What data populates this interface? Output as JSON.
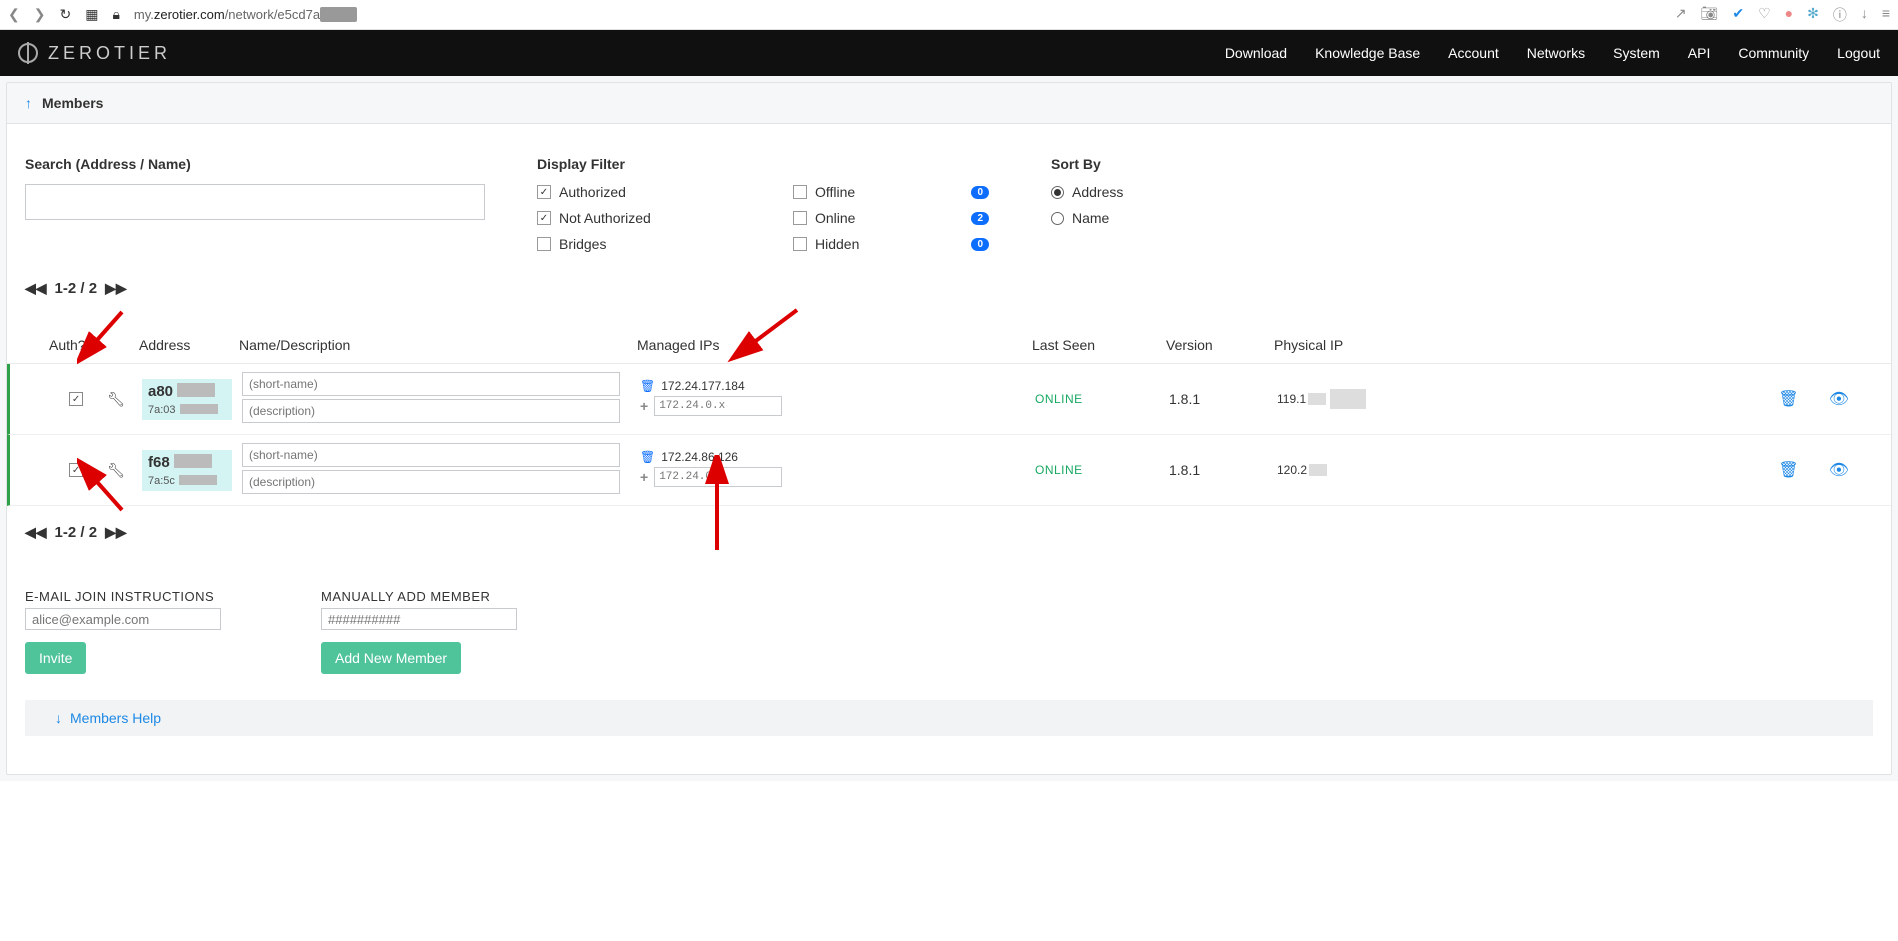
{
  "browser": {
    "url_prefix": "my.",
    "url_domain": "zerotier.com",
    "url_path": "/network/e5cd7a"
  },
  "nav": {
    "brand": "ZEROTIER",
    "links": [
      "Download",
      "Knowledge Base",
      "Account",
      "Networks",
      "System",
      "API",
      "Community",
      "Logout"
    ]
  },
  "section_title": "Members",
  "search_label": "Search (Address / Name)",
  "filter_label": "Display Filter",
  "sort_label": "Sort By",
  "filters_left": [
    {
      "label": "Authorized",
      "checked": true
    },
    {
      "label": "Not Authorized",
      "checked": true
    },
    {
      "label": "Bridges",
      "checked": false
    }
  ],
  "filters_right": [
    {
      "label": "Offline",
      "checked": false,
      "count": "0"
    },
    {
      "label": "Online",
      "checked": false,
      "count": "2"
    },
    {
      "label": "Hidden",
      "checked": false,
      "count": "0"
    }
  ],
  "sort_options": [
    {
      "label": "Address",
      "selected": true
    },
    {
      "label": "Name",
      "selected": false
    }
  ],
  "page_range": "1-2 / 2",
  "columns": {
    "auth": "Auth?",
    "address": "Address",
    "name": "Name/Description",
    "ips": "Managed IPs",
    "seen": "Last Seen",
    "version": "Version",
    "phys": "Physical IP"
  },
  "rows": [
    {
      "auth": true,
      "addr_main": "a80",
      "addr_sub": "7a:03",
      "short_ph": "(short-name)",
      "desc_ph": "(description)",
      "ip": "172.24.177.184",
      "ip_ph": "172.24.0.x",
      "seen": "ONLINE",
      "version": "1.8.1",
      "phys": "119.1"
    },
    {
      "auth": true,
      "addr_main": "f68",
      "addr_sub": "7a:5c",
      "short_ph": "(short-name)",
      "desc_ph": "(description)",
      "ip": "172.24.86.126",
      "ip_ph": "172.24.0.x",
      "seen": "ONLINE",
      "version": "1.8.1",
      "phys": "120.2"
    }
  ],
  "email_label": "E-MAIL JOIN INSTRUCTIONS",
  "email_ph": "alice@example.com",
  "invite_btn": "Invite",
  "manual_label": "MANUALLY ADD MEMBER",
  "manual_ph": "##########",
  "add_btn": "Add New Member",
  "help_text": "Members Help"
}
